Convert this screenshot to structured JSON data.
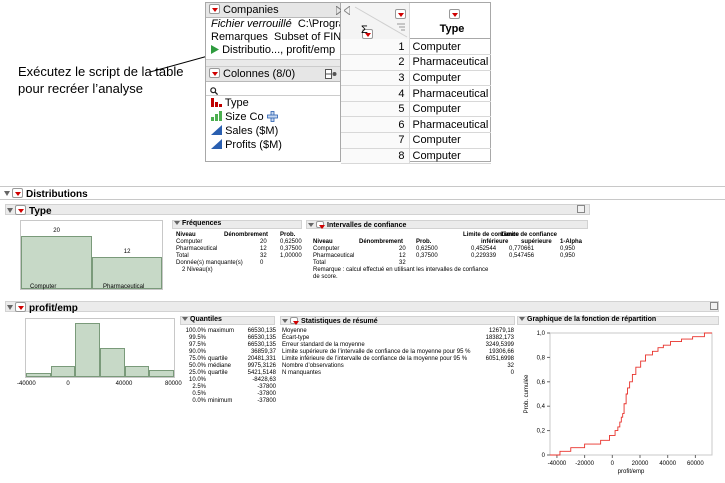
{
  "callout": {
    "line1": "Exécutez le script de la table",
    "line2": "pour recréer l’analyse"
  },
  "table_panel": {
    "title": "Companies",
    "locked_label": "Fichier verrouillé",
    "locked_value": "C:\\Progra",
    "notes_label": "Remarques",
    "notes_value": "Subset of FINA",
    "script_label": "Distributio..., profit/emp",
    "columns_title": "Colonnes (8/0)",
    "search_icon": "search-icon",
    "columns": [
      {
        "name": "Type",
        "icon": "nominal-bar-icon",
        "color": "#c00000"
      },
      {
        "name": "Size Co",
        "icon": "ordinal-bar-icon",
        "color": "#4caf50"
      },
      {
        "name": "Sales ($M)",
        "icon": "continuous-triangle-icon",
        "color": "#2a5fb0"
      },
      {
        "name": "Profits ($M)",
        "icon": "continuous-triangle-icon",
        "color": "#2a5fb0"
      }
    ]
  },
  "data_grid": {
    "header": "Type",
    "rows": [
      {
        "n": "1",
        "v": "Computer"
      },
      {
        "n": "2",
        "v": "Pharmaceutical"
      },
      {
        "n": "3",
        "v": "Computer"
      },
      {
        "n": "4",
        "v": "Pharmaceutical"
      },
      {
        "n": "5",
        "v": "Computer"
      },
      {
        "n": "6",
        "v": "Pharmaceutical"
      },
      {
        "n": "7",
        "v": "Computer"
      },
      {
        "n": "8",
        "v": "Computer"
      }
    ]
  },
  "report": {
    "title": "Distributions",
    "type_title": "Type",
    "freq": {
      "title": "Fréquences",
      "headers": [
        "Niveau",
        "Dénombrement",
        "Prob."
      ],
      "rows": [
        [
          "Computer",
          "20",
          "0,62500"
        ],
        [
          "Pharmaceutical",
          "12",
          "0,37500"
        ],
        [
          "Total",
          "32",
          "1,00000"
        ]
      ],
      "missing": "Donnée(s) manquante(s)",
      "missing_n": "0",
      "levels": "2 Niveau(x)"
    },
    "ci": {
      "title": "Intervalles de confiance",
      "headers": [
        "Niveau",
        "Dénombrement",
        "Prob.",
        "Limite de confiance inférieure",
        "Limite de confiance supérieure",
        "1-Alpha"
      ],
      "h_lower_1": "Limite de confiance",
      "h_lower_2": "inférieure",
      "h_upper_1": "Limite de confiance",
      "h_upper_2": "supérieure",
      "rows": [
        [
          "Computer",
          "20",
          "0,62500",
          "0,452544",
          "0,770661",
          "0,950"
        ],
        [
          "Pharmaceutical",
          "12",
          "0,37500",
          "0,229339",
          "0,547456",
          "0,950"
        ]
      ],
      "total": "Total",
      "total_n": "32",
      "remark1": "Remarque : calcul effectué en utilisant les intervalles de confiance",
      "remark2": "de score."
    },
    "profit_title": "profit/emp",
    "quantiles": {
      "title": "Quantiles",
      "rows": [
        [
          "100.0%",
          "maximum",
          "66530,135"
        ],
        [
          "99.5%",
          "",
          "66530,135"
        ],
        [
          "97.5%",
          "",
          "66530,135"
        ],
        [
          "90.0%",
          "",
          "36859,37"
        ],
        [
          "75.0%",
          "quartile",
          "20481,331"
        ],
        [
          "50.0%",
          "médiane",
          "9975,3126"
        ],
        [
          "25.0%",
          "quartile",
          "5421,5148"
        ],
        [
          "10.0%",
          "",
          "-8428,63"
        ],
        [
          "2.5%",
          "",
          "-37800"
        ],
        [
          "0.5%",
          "",
          "-37800"
        ],
        [
          "0.0%",
          "minimum",
          "-37800"
        ]
      ]
    },
    "summary": {
      "title": "Statistiques de résumé",
      "rows": [
        [
          "Moyenne",
          "12679,18"
        ],
        [
          "Écart-type",
          "18382,173"
        ],
        [
          "Erreur standard de la moyenne",
          "3249,5399"
        ],
        [
          "Limite supérieure de l’intervalle de confiance de la moyenne pour 95 %",
          "19306,66"
        ],
        [
          "Limite inférieure de l’intervalle de confiance de la moyenne pour 95 %",
          "6051,6998"
        ],
        [
          "Nombre d’observations",
          "32"
        ],
        [
          "N manquantes",
          "0"
        ]
      ]
    },
    "cdf_title": "Graphique de la fonction de répartition"
  },
  "chart_data": [
    {
      "type": "bar",
      "categories": [
        "Computer",
        "Pharmaceutical"
      ],
      "values": [
        20,
        12
      ],
      "title": "",
      "xlabel": "",
      "ylabel": "",
      "ylim": [
        0,
        24
      ]
    },
    {
      "type": "bar",
      "x_bins": [
        [
          -40000,
          -20000
        ],
        [
          -20000,
          0
        ],
        [
          0,
          20000
        ],
        [
          20000,
          40000
        ],
        [
          40000,
          60000
        ],
        [
          60000,
          80000
        ]
      ],
      "values": [
        1,
        3,
        15,
        8,
        3,
        2
      ],
      "x_ticks": [
        "-40000",
        "0",
        "40000",
        "80000"
      ],
      "xlim": [
        -40000,
        80000
      ],
      "title": "",
      "xlabel": "",
      "ylabel": ""
    },
    {
      "type": "line",
      "x": [
        -37800,
        -30000,
        -20000,
        -8428,
        -2000,
        2000,
        4000,
        5421,
        6500,
        7500,
        8500,
        9975,
        11000,
        12500,
        14500,
        17000,
        20481,
        24000,
        29000,
        33000,
        36859,
        42000,
        50000,
        58000,
        66530
      ],
      "y": [
        0.03,
        0.06,
        0.09,
        0.12,
        0.16,
        0.2,
        0.23,
        0.27,
        0.31,
        0.34,
        0.42,
        0.5,
        0.55,
        0.6,
        0.66,
        0.72,
        0.77,
        0.82,
        0.85,
        0.88,
        0.9,
        0.93,
        0.95,
        0.97,
        1.0
      ],
      "x_ticks": [
        "-40000",
        "-20000",
        "0",
        "20000",
        "40000",
        "60000"
      ],
      "y_ticks": [
        "0",
        "0,2",
        "0,4",
        "0,6",
        "0,8",
        "1,0"
      ],
      "xlim": [
        -45000,
        72000
      ],
      "ylim": [
        0,
        1
      ],
      "xlabel": "profit/emp",
      "ylabel": "Prob. cumulée",
      "color": "#e8302a"
    }
  ]
}
